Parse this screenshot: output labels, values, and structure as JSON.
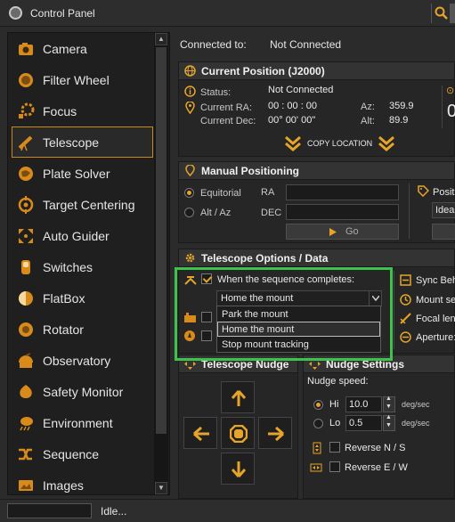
{
  "window": {
    "title": "Control Panel"
  },
  "sidebar": {
    "items": [
      {
        "label": "Camera",
        "icon": "camera-icon"
      },
      {
        "label": "Filter Wheel",
        "icon": "filter-wheel-icon"
      },
      {
        "label": "Focus",
        "icon": "focus-icon"
      },
      {
        "label": "Telescope",
        "icon": "telescope-icon",
        "active": true
      },
      {
        "label": "Plate Solver",
        "icon": "plate-solver-icon"
      },
      {
        "label": "Target Centering",
        "icon": "target-icon"
      },
      {
        "label": "Auto Guider",
        "icon": "guider-icon"
      },
      {
        "label": "Switches",
        "icon": "switch-icon"
      },
      {
        "label": "FlatBox",
        "icon": "flatbox-icon"
      },
      {
        "label": "Rotator",
        "icon": "rotator-icon"
      },
      {
        "label": "Observatory",
        "icon": "observatory-icon"
      },
      {
        "label": "Safety Monitor",
        "icon": "safety-icon"
      },
      {
        "label": "Environment",
        "icon": "environment-icon"
      },
      {
        "label": "Sequence",
        "icon": "sequence-icon"
      },
      {
        "label": "Images",
        "icon": "images-icon"
      }
    ]
  },
  "connection": {
    "label": "Connected to:",
    "value": "Not Connected"
  },
  "current_position": {
    "title": "Current Position (J2000)",
    "status_label": "Status:",
    "status_value": "Not Connected",
    "ra_label": "Current RA:",
    "ra_value": "00 : 00 : 00",
    "dec_label": "Current Dec:",
    "dec_value": "00° 00' 00\"",
    "az_label": "Az:",
    "az_value": "359.9",
    "alt_label": "Alt:",
    "alt_value": "89.9",
    "copy_label": "COPY LOCATION",
    "partial_right": "0"
  },
  "manual_positioning": {
    "title": "Manual Positioning",
    "equatorial_label": "Equitorial",
    "altaz_label": "Alt / Az",
    "ra_label": "RA",
    "dec_label": "DEC",
    "go_label": "Go",
    "position_partial": "Positi",
    "ideal_partial": "Ideal"
  },
  "telescope_options": {
    "title": "Telescope Options / Data",
    "sequence_label": "When the sequence completes:",
    "selected_value": "Home the mount",
    "options": [
      "Park the mount",
      "Home the mount",
      "Stop mount tracking"
    ],
    "selected_index": 1,
    "sync_partial": "Sync Beh",
    "mount_partial": "Mount set",
    "focal_partial": "Focal leng",
    "aperture_partial": "Aperture:"
  },
  "nudge": {
    "title": "Telescope Nudge",
    "settings_title": "Nudge Settings",
    "speed_label": "Nudge speed:",
    "hi_label": "Hi",
    "hi_value": "10.0",
    "lo_label": "Lo",
    "lo_value": "0.5",
    "unit": "deg/sec",
    "reverse_ns": "Reverse N / S",
    "reverse_ew": "Reverse E / W"
  },
  "status_bar": {
    "text": "Idle..."
  },
  "colors": {
    "accent": "#e6a52a",
    "highlight": "#3ec24e"
  }
}
